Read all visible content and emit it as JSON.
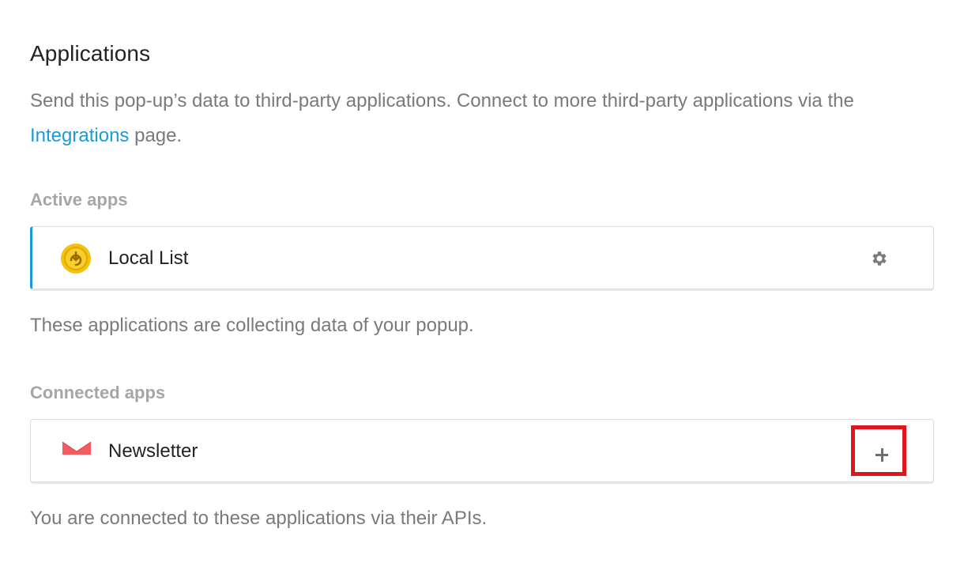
{
  "header": {
    "title": "Applications",
    "description_before_link": "Send this pop-up’s data to third-party applications. Connect to more third-party applications via the ",
    "link_text": "Integrations",
    "description_after_link": " page."
  },
  "active_apps": {
    "label": "Active apps",
    "items": [
      {
        "name": "Local List",
        "icon": "local-list-icon",
        "action_icon": "gear-icon"
      }
    ],
    "note": "These applications are collecting data of your popup."
  },
  "connected_apps": {
    "label": "Connected apps",
    "items": [
      {
        "name": "Newsletter",
        "icon": "mail-icon",
        "action_icon": "plus-icon"
      }
    ],
    "note": "You are connected to these applications via their APIs."
  },
  "colors": {
    "accent": "#1a9bd7",
    "highlight_border": "#e0141c",
    "newsletter_icon": "#f25b5f",
    "local_list_icon": "#f4c20d"
  }
}
